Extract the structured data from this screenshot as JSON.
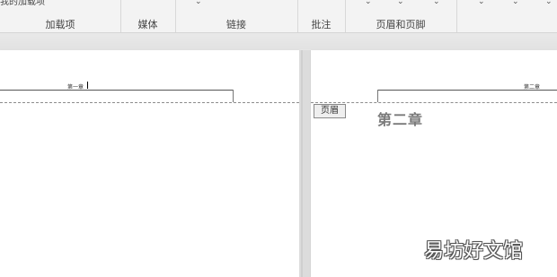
{
  "ribbon": {
    "top_row_text": "我的加载项",
    "groups": [
      {
        "label": "加载项"
      },
      {
        "label": "媒体"
      },
      {
        "label": "链接"
      },
      {
        "label": "批注"
      },
      {
        "label": "页眉和页脚"
      }
    ],
    "chevron_glyph": "⌄"
  },
  "left_page": {
    "header_text": "第一章"
  },
  "right_page": {
    "header_text": "第二章",
    "header_tag": "页眉",
    "chapter_title": "第二章"
  },
  "watermark": "易坊好文馆"
}
